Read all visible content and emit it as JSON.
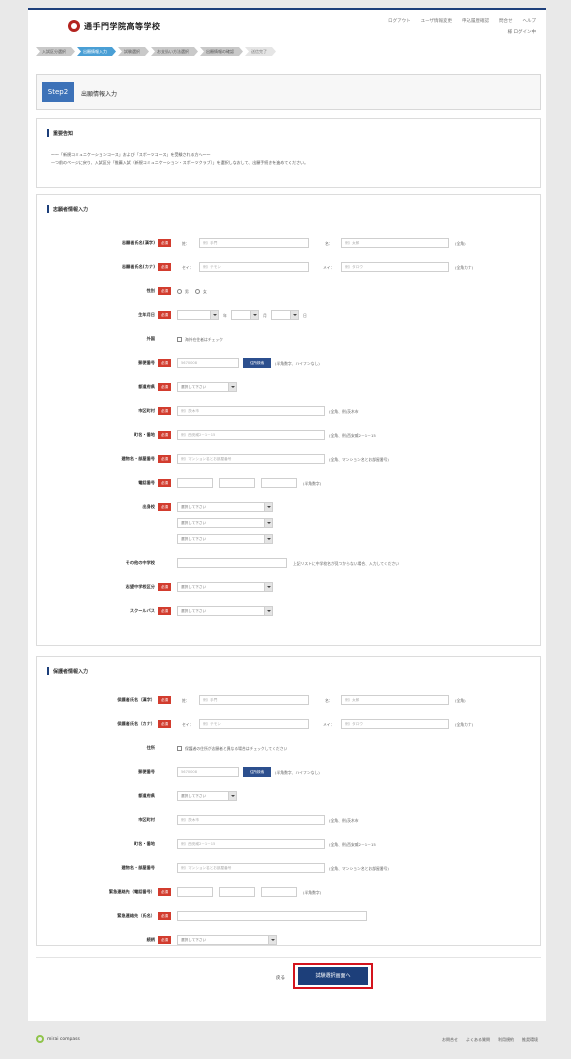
{
  "header": {
    "school": "通手門学院高等学校",
    "topnav": [
      "ログアウト",
      "ユーザ情報変更",
      "申込履歴確認",
      "問合せ",
      "ヘルプ"
    ],
    "user": "様 ログイン中"
  },
  "steps": [
    "入試区分選択",
    "出願情報入力",
    "試験選択",
    "お支払い方法選択",
    "出願情報の確認",
    "送信完了"
  ],
  "page": {
    "step_label": "Step2",
    "step_title": "出願情報入力"
  },
  "notice": {
    "title": "重要告知",
    "lines": [
      "～～「新規コミュニケーションコース」および「スポーツコース」を受験される方へ～～",
      "一つ前のページに戻り、入試区分「推薦入試（新規コミュニケーション・スポーツクラブ）」を選択しなおして、出願手続きを進めてください。"
    ]
  },
  "applicant": {
    "title": "志願者情報入力",
    "req": "必須",
    "name_kanji": {
      "label": "志願者氏名(漢字)",
      "sei": "姓：",
      "mei": "名：",
      "sei_ph": "例）手門",
      "mei_ph": "例）太郎",
      "note": "(全角)"
    },
    "name_kana": {
      "label": "志願者氏名(カナ)",
      "sei": "セイ：",
      "mei": "メイ：",
      "sei_ph": "例）テモン",
      "mei_ph": "例）タロウ",
      "note": "(全角カナ)"
    },
    "gender": {
      "label": "性別",
      "male": "男",
      "female": "女"
    },
    "birth": {
      "label": "生年月日",
      "year": "年",
      "month": "月",
      "day": "日"
    },
    "foreign": {
      "label": "外国",
      "check": "海外在住者はチェック"
    },
    "postal": {
      "label": "郵便番号",
      "ph": "5670008",
      "btn": "住所検索",
      "note": "(半角数字、ハイフンなし)"
    },
    "pref": {
      "label": "都道府県",
      "value": "選択して下さい"
    },
    "city": {
      "label": "市区町村",
      "ph": "例）茨木市",
      "note": "(全角、例)茨木市"
    },
    "addr": {
      "label": "町名・番地",
      "ph": "例）西安威2－1－15",
      "note": "(全角、例)西安威2－1－15"
    },
    "bldg": {
      "label": "建物名・部屋番号",
      "ph": "例）マンション名とお部屋番号",
      "note": "(全角、マンション名とお部屋番号)"
    },
    "phone": {
      "label": "電話番号",
      "note": "(半角数字)"
    },
    "school": {
      "label": "出身校",
      "value": "選択して下さい"
    },
    "other_school": {
      "label": "その他の中学校",
      "note": "上記リストに中学校名が見つからない場合、入力してください"
    },
    "course": {
      "label": "志望中学校区分",
      "value": "選択して下さい"
    },
    "bus": {
      "label": "スクールバス",
      "value": "選択して下さい"
    }
  },
  "guardian": {
    "title": "保護者情報入力",
    "name_kanji": {
      "label": "保護者氏名（漢字）",
      "sei": "姓：",
      "mei": "名：",
      "sei_ph": "例）手門",
      "mei_ph": "例）太郎",
      "note": "(全角)"
    },
    "name_kana": {
      "label": "保護者氏名（カナ）",
      "sei": "セイ：",
      "mei": "メイ：",
      "sei_ph": "例）テモン",
      "mei_ph": "例）タロウ",
      "note": "(全角カナ)"
    },
    "same": {
      "label": "住所",
      "check": "保護者の住所が志願者と異なる場合はチェックしてください"
    },
    "postal": {
      "label": "郵便番号",
      "ph": "5670008",
      "btn": "住所検索",
      "note": "(半角数字、ハイフンなし)"
    },
    "pref": {
      "label": "都道府県",
      "value": "選択して下さい"
    },
    "city": {
      "label": "市区町村",
      "ph": "例）茨木市",
      "note": "(全角、例)茨木市"
    },
    "addr": {
      "label": "町名・番地",
      "ph": "例）西安威2－1－15",
      "note": "(全角、例)西安威2－1－15"
    },
    "bldg": {
      "label": "建物名・部屋番号",
      "ph": "例）マンション名とお部屋番号",
      "note": "(全角、マンション名とお部屋番号)"
    },
    "emergency": {
      "label": "緊急連絡先（電話番号）",
      "note": "(半角数字)"
    },
    "emergency_name": {
      "label": "緊急連絡先（氏名）"
    },
    "relation": {
      "label": "続柄",
      "value": "選択して下さい"
    }
  },
  "actions": {
    "back": "戻る",
    "next": "試験選択画面へ"
  },
  "footer": {
    "brand": "mirai compass",
    "links": [
      "お問合せ",
      "よくある質問",
      "利用規約",
      "推奨環境"
    ]
  }
}
